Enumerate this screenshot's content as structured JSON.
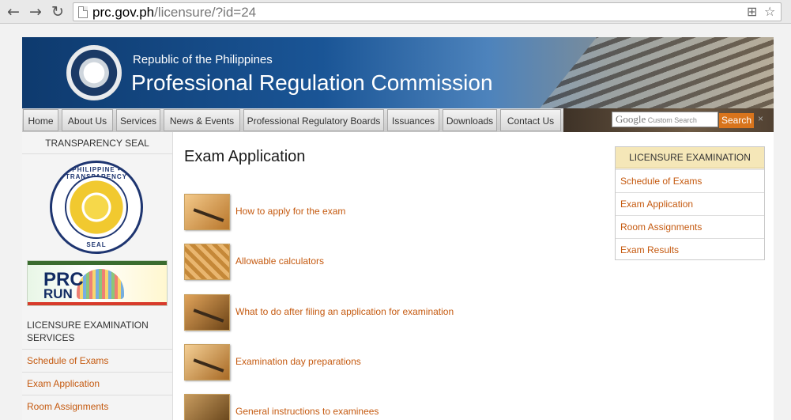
{
  "browser": {
    "url_domain": "prc.gov.ph",
    "url_path": "/licensure/?id=24",
    "icons": [
      "back-arrow-icon",
      "forward-arrow-icon",
      "reload-icon",
      "translate-icon",
      "star-icon"
    ]
  },
  "header": {
    "subtitle": "Republic of the Philippines",
    "title": "Professional Regulation Commission"
  },
  "nav": [
    {
      "label": "Home"
    },
    {
      "label": "About Us"
    },
    {
      "label": "Services"
    },
    {
      "label": "News & Events"
    },
    {
      "label": "Professional Regulatory Boards"
    },
    {
      "label": "Issuances"
    },
    {
      "label": "Downloads"
    },
    {
      "label": "Contact Us"
    }
  ],
  "search": {
    "brand": "Google",
    "placeholder": "Custom Search",
    "button": "Search",
    "close": "×"
  },
  "left_sidebar": {
    "seal_title": "TRANSPARENCY SEAL",
    "seal_top_text": "PHILIPPINE • TRANSPARENCY",
    "seal_bottom_text": "SEAL",
    "banner_line1": "PRC",
    "banner_line2": "RUN",
    "section_title": "LICENSURE EXAMINATION SERVICES",
    "links": [
      "Schedule of Exams",
      "Exam Application",
      "Room Assignments"
    ]
  },
  "main": {
    "title": "Exam Application",
    "items": [
      {
        "label": "How to apply for the exam"
      },
      {
        "label": "Allowable calculators"
      },
      {
        "label": "What to do after filing an application for examination"
      },
      {
        "label": "Examination day preparations"
      },
      {
        "label": "General instructions to examinees"
      }
    ]
  },
  "right_sidebar": {
    "title": "LICENSURE EXAMINATION",
    "links": [
      "Schedule of Exams",
      "Exam Application",
      "Room Assignments",
      "Exam Results"
    ]
  },
  "colors": {
    "link": "#c55a10",
    "header_blue": "#1a5596",
    "accent_orange": "#d8741c",
    "right_head_bg": "#f5e7b8"
  }
}
